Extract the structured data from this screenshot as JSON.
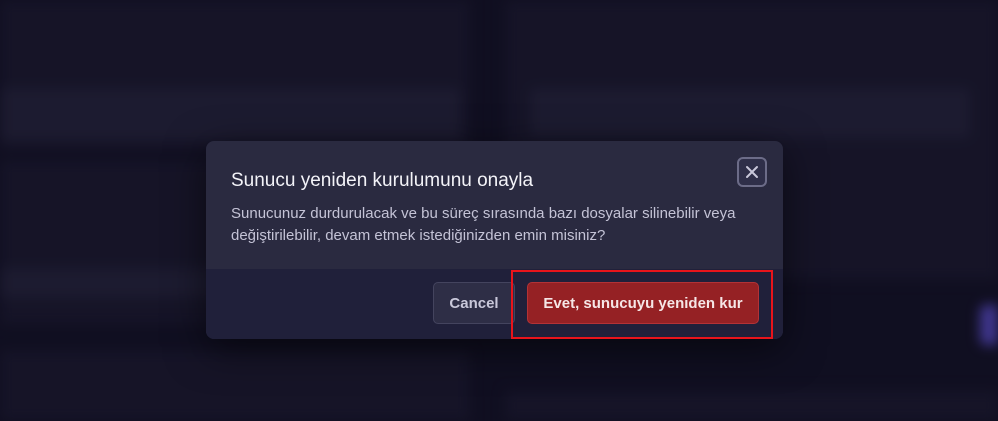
{
  "background": {
    "left_items": [
      "",
      "",
      "",
      "",
      ""
    ],
    "right_items": [
      "",
      "",
      ""
    ]
  },
  "dialog": {
    "title": "Sunucu yeniden kurulumunu onayla",
    "message": "Sunucunuz durdurulacak ve bu süreç sırasında bazı dosyalar silinebilir veya değiştirilebilir, devam etmek istediğinizden emin misiniz?",
    "close_icon": "close-icon",
    "cancel_label": "Cancel",
    "confirm_label": "Evet, sunucuyu yeniden kur"
  },
  "colors": {
    "confirm_button": "#952124",
    "highlight": "#e8141b",
    "modal_background": "#2a2a40"
  }
}
